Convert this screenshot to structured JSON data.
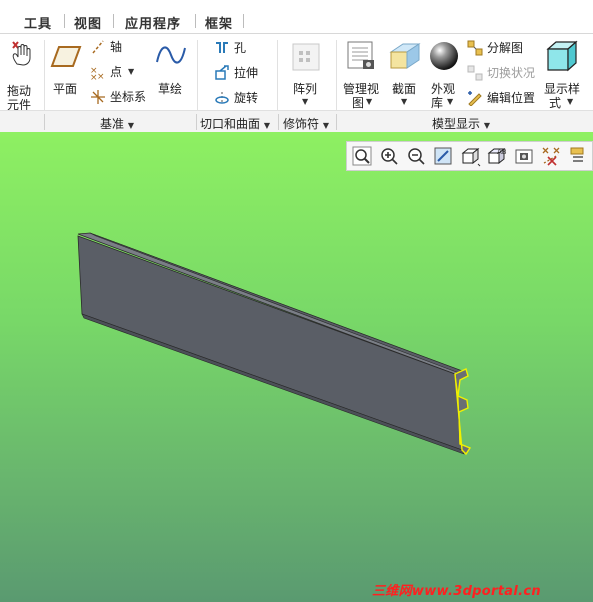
{
  "menu": {
    "tabs": [
      "工具",
      "视图",
      "应用程序",
      "框架"
    ]
  },
  "ribbon": {
    "drag_component": {
      "line1": "拖动",
      "line2": "元件"
    },
    "plane": "平面",
    "axis": "轴",
    "point": "点",
    "coord_sys": "坐标系",
    "sketch": "草绘",
    "hole": "孔",
    "extrude": "拉伸",
    "revolve": "旋转",
    "pattern": "阵列",
    "manage_views": {
      "line1": "管理视",
      "line2": "图"
    },
    "section": "截面",
    "appearance": {
      "line1": "外观",
      "line2": "库"
    },
    "exploded_view": "分解图",
    "toggle_status": "切换状况",
    "edit_position": "编辑位置",
    "display_style": {
      "line1": "显示样",
      "line2": "式"
    }
  },
  "groups": {
    "datum": "基准",
    "cuts_surfaces": "切口和曲面",
    "modifiers": "修饰符",
    "model_display": "模型显示"
  },
  "view_toolbar": {
    "icons": [
      "zoom-fit-icon",
      "zoom-in-icon",
      "zoom-out-icon",
      "repaint-icon",
      "display-style-icon",
      "saved-views-icon",
      "perspective-icon",
      "datum-display-icon",
      "annotation-display-icon"
    ]
  },
  "viewport": {
    "top_color": "#8ef062",
    "bottom_color": "#5a9a70",
    "model_color": "#5a5e66",
    "highlight_color": "#f0f000"
  },
  "watermark": "三维网www.3dportal.cn"
}
